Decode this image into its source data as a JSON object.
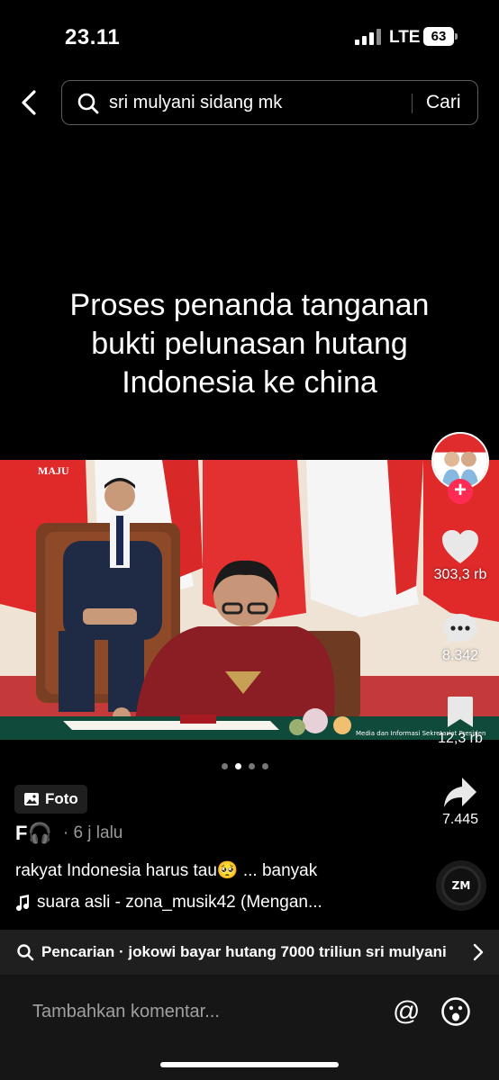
{
  "status_bar": {
    "time": "23.11",
    "network": "LTE",
    "battery": "63"
  },
  "search": {
    "query": "sri mulyani sidang mk",
    "submit_label": "Cari"
  },
  "caption": {
    "line1": "Proses penanda tanganan",
    "line2": "bukti pelunasan hutang",
    "line3": "Indonesia ke china"
  },
  "photo": {
    "watermark": "MAJU"
  },
  "carousel": {
    "total": 4,
    "active": 1
  },
  "actions": {
    "likes": "303,3 rb",
    "comments": "8.342",
    "saves": "12,3 rb",
    "shares": "7.445"
  },
  "post": {
    "type_label": "Foto",
    "author": "F🎧",
    "time": "· 6 j lalu",
    "description": "rakyat Indonesia harus tau🥺",
    "more_label": "... banyak",
    "music": "suara asli - zona_musik42 (Mengan...",
    "music_disc_label": "ZM"
  },
  "related_search": {
    "text": "Pencarian · jokowi bayar hutang 7000 triliun sri mulyani"
  },
  "comment": {
    "placeholder": "Tambahkan komentar...",
    "at_label": "@"
  },
  "colors": {
    "accent": "#fe2c55",
    "background": "#000000",
    "bar": "#1f1f1f"
  }
}
